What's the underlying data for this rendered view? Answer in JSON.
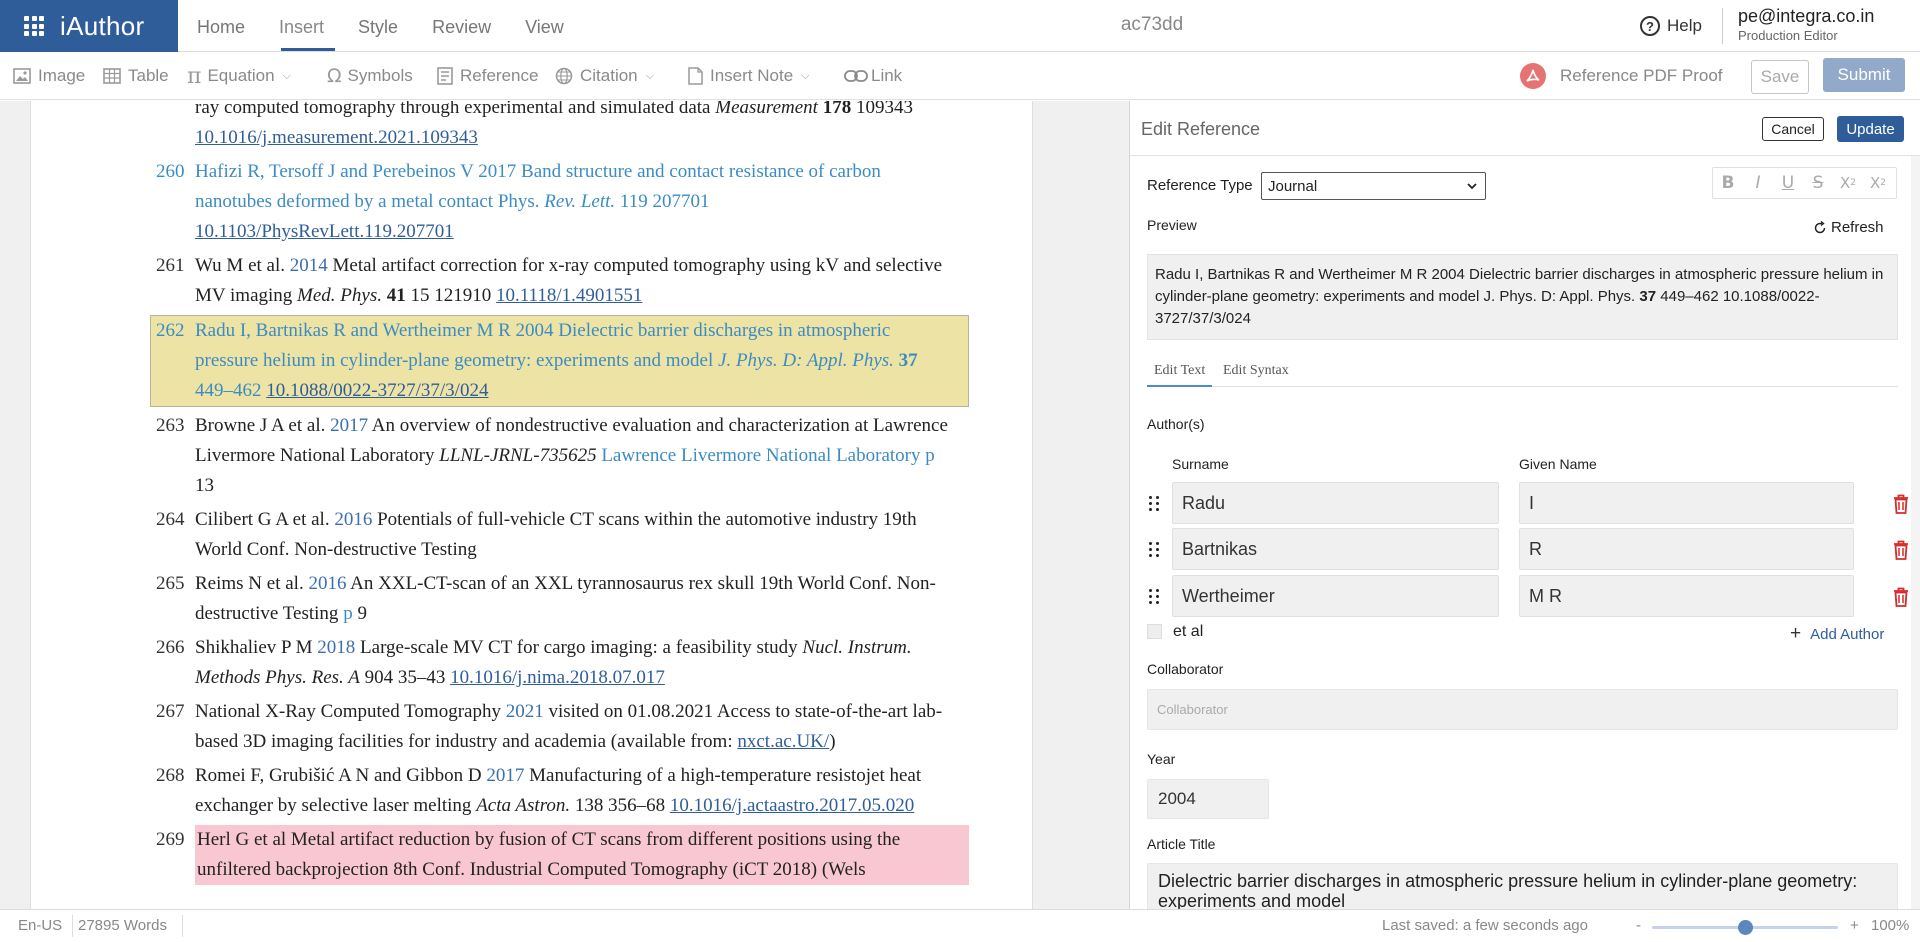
{
  "app": {
    "name": "iAuthor"
  },
  "nav": {
    "items": [
      "Home",
      "Insert",
      "Style",
      "Review",
      "View"
    ],
    "active": "Insert",
    "doc_id": "ac73dd",
    "help_label": "Help",
    "user_email": "pe@integra.co.in",
    "user_role": "Production Editor"
  },
  "toolbar": {
    "image": "Image",
    "table": "Table",
    "equation": "Equation",
    "symbols": "Symbols",
    "reference": "Reference",
    "citation": "Citation",
    "insert_note": "Insert Note",
    "link": "Link",
    "pdf_proof": "Reference PDF Proof",
    "save": "Save",
    "submit": "Submit"
  },
  "document": {
    "references": [
      {
        "num": "",
        "parts": [
          {
            "t": "ray computed tomography through experimental and simulated data "
          },
          {
            "t": "Measurement",
            "s": "it"
          },
          {
            "t": " "
          },
          {
            "t": "178",
            "s": "bd"
          },
          {
            "t": " 109343 "
          },
          {
            "t": "10.1016/j.measurement.2021.109343",
            "s": "lk"
          }
        ]
      },
      {
        "num": "260",
        "style": "blue",
        "parts": [
          {
            "t": "Hafizi R, Tersoff J and Perebeinos V 2017 Band structure and contact resistance of carbon nanotubes deformed by a metal contact Phys. "
          },
          {
            "t": "Rev. Lett.",
            "s": "it"
          },
          {
            "t": " 119 207701 "
          },
          {
            "t": "10.1103/PhysRevLett.119.207701",
            "s": "lk"
          }
        ]
      },
      {
        "num": "261",
        "parts": [
          {
            "t": "Wu M et al. "
          },
          {
            "t": "2014",
            "s": "yr"
          },
          {
            "t": " Metal artifact correction for x-ray computed tomography using kV and selective MV imaging "
          },
          {
            "t": "Med. Phys.",
            "s": "it"
          },
          {
            "t": " "
          },
          {
            "t": "41",
            "s": "bd"
          },
          {
            "t": " 15 121910 "
          },
          {
            "t": "10.1118/1.4901551",
            "s": "lk"
          }
        ]
      },
      {
        "num": "262",
        "style": "blue hl",
        "parts": [
          {
            "t": "Radu I, Bartnikas R and Wertheimer M R 2004 Dielectric barrier discharges in atmospheric pressure helium in cylinder-plane geometry: experiments and model "
          },
          {
            "t": "J. Phys. D: Appl. Phys.",
            "s": "it"
          },
          {
            "t": " "
          },
          {
            "t": "37",
            "s": "bd"
          },
          {
            "t": " 449–462 "
          },
          {
            "t": "10.1088/0022-3727/37/3/024",
            "s": "lk"
          }
        ]
      },
      {
        "num": "263",
        "parts": [
          {
            "t": "Browne J A et al. "
          },
          {
            "t": "2017",
            "s": "yr"
          },
          {
            "t": " An overview of nondestructive evaluation and characterization at Lawrence Livermore National Laboratory "
          },
          {
            "t": "LLNL-JRNL-735625",
            "s": "it"
          },
          {
            "t": " "
          },
          {
            "t": "Lawrence Livermore National Laboratory",
            "s": "bl"
          },
          {
            "t": " "
          },
          {
            "t": "p",
            "s": "bl"
          },
          {
            "t": " 13"
          }
        ]
      },
      {
        "num": "264",
        "parts": [
          {
            "t": "Cilibert G A et al. "
          },
          {
            "t": "2016",
            "s": "yr"
          },
          {
            "t": " Potentials of full-vehicle CT scans within the automotive industry 19th World Conf. Non-destructive Testing"
          }
        ]
      },
      {
        "num": "265",
        "parts": [
          {
            "t": "Reims N et al. "
          },
          {
            "t": "2016",
            "s": "yr"
          },
          {
            "t": " An XXL-CT-scan of an XXL tyrannosaurus rex skull 19th World Conf. Non-destructive Testing "
          },
          {
            "t": "p",
            "s": "bl"
          },
          {
            "t": " 9"
          }
        ]
      },
      {
        "num": "266",
        "parts": [
          {
            "t": "Shikhaliev P M "
          },
          {
            "t": "2018",
            "s": "yr"
          },
          {
            "t": " Large-scale MV CT for cargo imaging: a feasibility study "
          },
          {
            "t": "Nucl. Instrum. Methods Phys. Res. A",
            "s": "it"
          },
          {
            "t": " 904 35–43 "
          },
          {
            "t": "10.1016/j.nima.2018.07.017",
            "s": "lk"
          }
        ]
      },
      {
        "num": "267",
        "parts": [
          {
            "t": "National X-Ray Computed Tomography "
          },
          {
            "t": "2021",
            "s": "yr"
          },
          {
            "t": " visited on 01.08.2021 Access to state-of-the-art lab-based 3D imaging facilities for industry and academia (available from: "
          },
          {
            "t": "nxct.ac.UK/",
            "s": "lk"
          },
          {
            "t": ")"
          }
        ]
      },
      {
        "num": "268",
        "parts": [
          {
            "t": "Romei F, Grubišić A N and Gibbon D "
          },
          {
            "t": "2017",
            "s": "yr"
          },
          {
            "t": " Manufacturing of a high-temperature resistojet heat exchanger by selective laser melting "
          },
          {
            "t": "Acta Astron.",
            "s": "it"
          },
          {
            "t": " 138 356–68 "
          },
          {
            "t": "10.1016/j.actaastro.2017.05.020",
            "s": "lk"
          }
        ]
      },
      {
        "num": "269",
        "style": "pink",
        "parts": [
          {
            "t": "Herl G et al Metal artifact reduction by fusion of CT scans from different positions using the unfiltered backprojection 8th Conf. Industrial Computed Tomography (iCT 2018) (Wels"
          }
        ]
      }
    ]
  },
  "panel": {
    "title": "Edit Reference",
    "cancel": "Cancel",
    "update": "Update",
    "ref_type_label": "Reference Type",
    "ref_type_value": "Journal",
    "preview_label": "Preview",
    "refresh": "Refresh",
    "preview": {
      "before": "Radu I, Bartnikas R and Wertheimer M R 2004 Dielectric barrier discharges in atmospheric pressure helium in cylinder-plane geometry: experiments and model J. Phys. D: Appl. Phys. ",
      "volume": "37",
      "after": " 449–462 10.1088/0022-3727/37/3/024"
    },
    "tabs": [
      "Edit Text",
      "Edit Syntax"
    ],
    "authors_label": "Author(s)",
    "surname_label": "Surname",
    "given_label": "Given Name",
    "authors": [
      {
        "surname": "Radu",
        "given": "I"
      },
      {
        "surname": "Bartnikas",
        "given": "R"
      },
      {
        "surname": "Wertheimer",
        "given": "M R"
      }
    ],
    "et_al": "et al",
    "add_author": "Add Author",
    "collaborator_label": "Collaborator",
    "collaborator_placeholder": "Collaborator",
    "year_label": "Year",
    "year": "2004",
    "article_title_label": "Article Title",
    "article_title": "Dielectric barrier discharges in atmospheric pressure helium in cylinder-plane geometry: experiments and model"
  },
  "status": {
    "lang": "En-US",
    "words": "27895 Words",
    "saved": "Last saved: a few seconds ago",
    "zoom_minus": "-",
    "zoom_plus": "+",
    "zoom": "100%",
    "zoom_level": 0.5
  },
  "colors": {
    "brand": "#2f5d9a",
    "highlight": "#ede3a4",
    "pink": "#f8c7d2",
    "link_blue": "#3b8cc4"
  }
}
